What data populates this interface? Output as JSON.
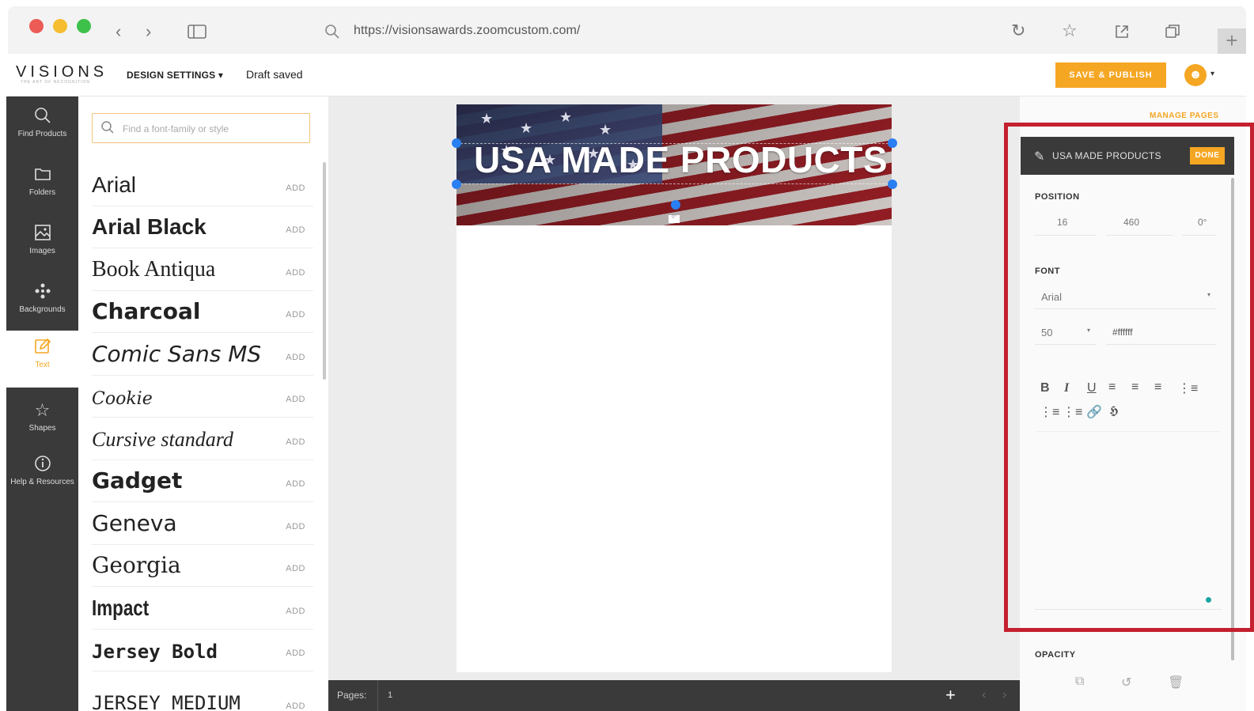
{
  "browser": {
    "url": "https://visionsawards.zoomcustom.com/",
    "new_tab": "+"
  },
  "header": {
    "logo": "VISIONS",
    "logo_tagline": "THE ART OF RECOGNITION",
    "design_settings": "DESIGN SETTINGS ▾",
    "draft_status": "Draft saved",
    "save_publish": "SAVE & PUBLISH",
    "avatar_caret": "▾"
  },
  "sidebar": {
    "items": [
      {
        "label": "Find Products",
        "icon": "search-icon"
      },
      {
        "label": "Folders",
        "icon": "folder-icon"
      },
      {
        "label": "Images",
        "icon": "image-icon"
      },
      {
        "label": "Backgrounds",
        "icon": "backgrounds-icon"
      },
      {
        "label": "Text",
        "icon": "edit-icon"
      },
      {
        "label": "Shapes",
        "icon": "star-icon"
      },
      {
        "label": "Help & Resources",
        "icon": "info-icon"
      }
    ]
  },
  "font_panel": {
    "search_placeholder": "Find a font-family or style",
    "add_label": "ADD",
    "fonts": [
      "Arial",
      "Arial Black",
      "Book Antiqua",
      "Charcoal",
      "Comic Sans MS",
      "Cookie",
      "Cursive standard",
      "Gadget",
      "Geneva",
      "Georgia",
      "Impact",
      "Jersey Bold",
      "JERSEY MEDIUM"
    ]
  },
  "canvas": {
    "banner_text": "USA MADE PRODUCTS",
    "rotation_label": "0°"
  },
  "pages_bar": {
    "label": "Pages:",
    "page_number": "1",
    "add": "+"
  },
  "right_panel": {
    "manage_pages": "MANAGE PAGES",
    "element_title": "USA MADE PRODUCTS",
    "done": "DONE",
    "position_label": "POSITION",
    "pos_x": "16",
    "pos_y": "460",
    "pos_rot": "0°",
    "font_label": "FONT",
    "font_family": "Arial",
    "font_size": "50",
    "font_color": "#ffffff",
    "opacity_label": "OPACITY"
  },
  "colors": {
    "accent": "#f5a623",
    "sidebar_bg": "#3a3a3a",
    "highlight": "#c4202f",
    "handle": "#2a7ff2"
  }
}
